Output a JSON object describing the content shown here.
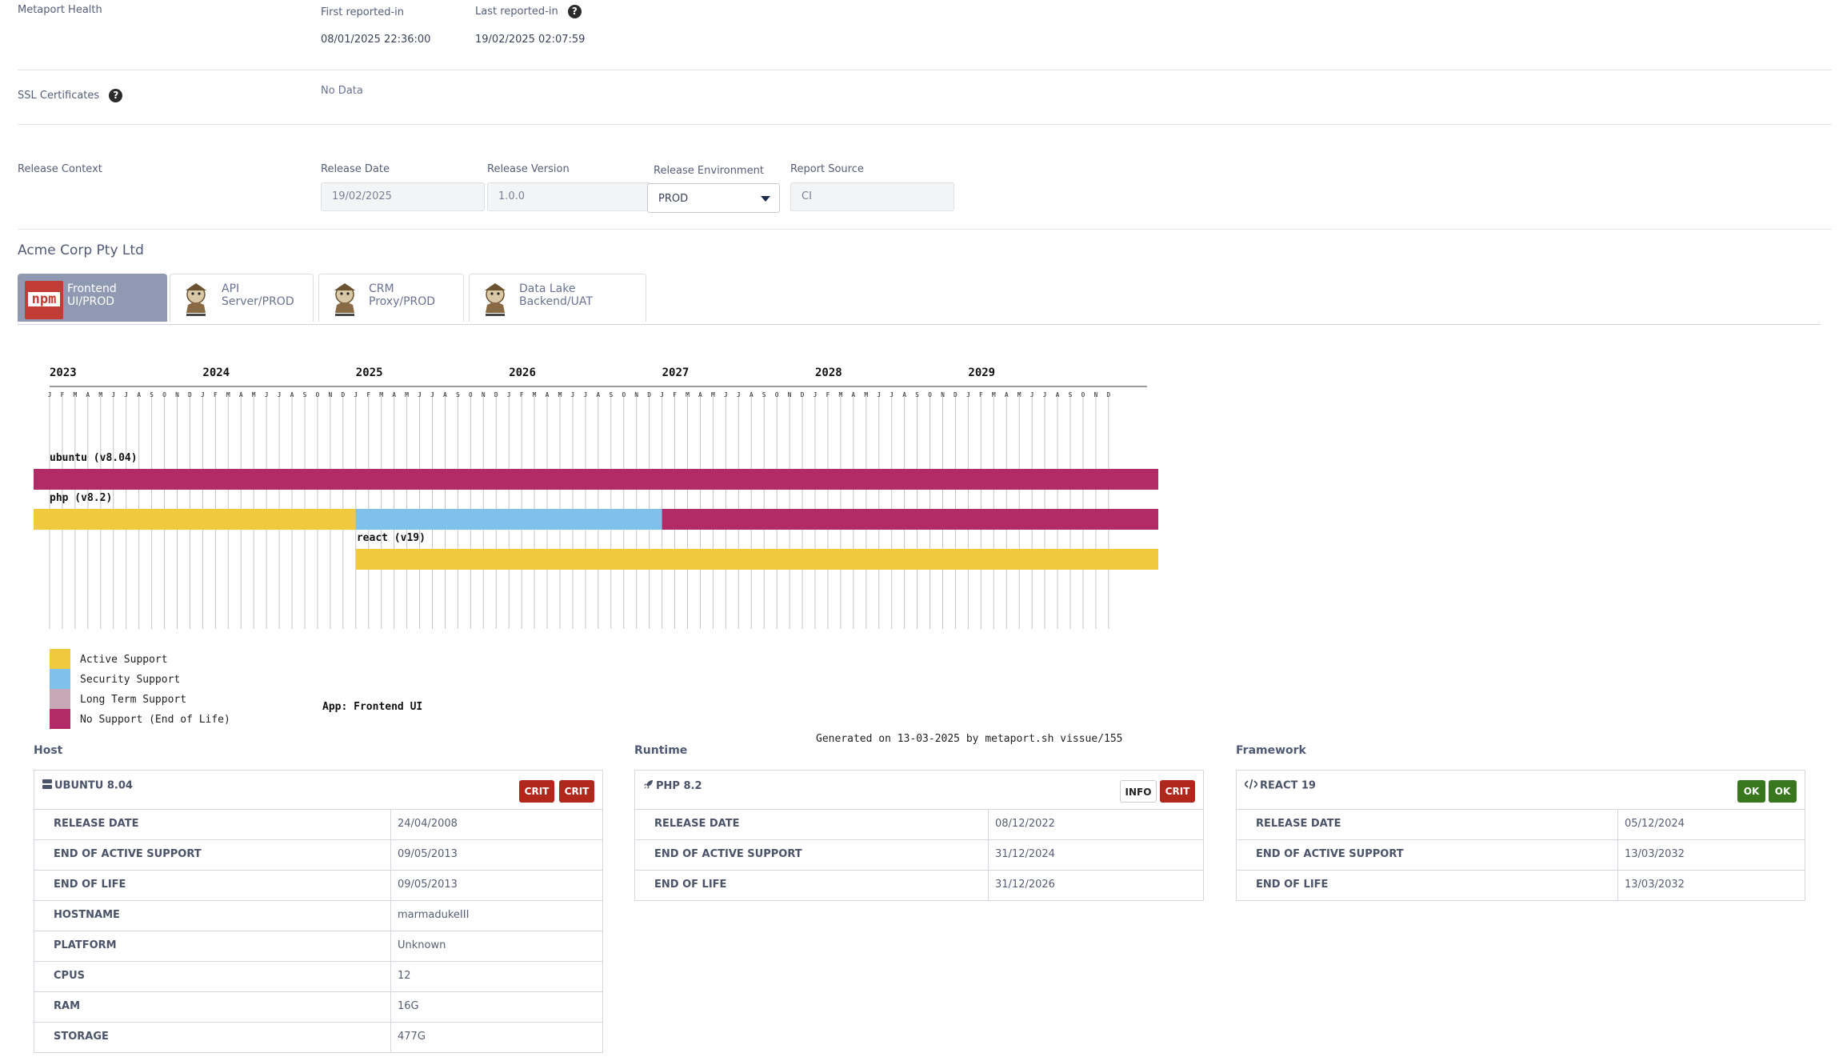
{
  "health": {
    "label": "Metaport Health",
    "first_label": "First reported-in",
    "first_value": "08/01/2025 22:36:00",
    "last_label": "Last reported-in",
    "last_value": "19/02/2025 02:07:59",
    "help": "?"
  },
  "ssl": {
    "label": "SSL Certificates",
    "value": "No Data",
    "help": "?"
  },
  "release": {
    "label": "Release Context",
    "date_label": "Release Date",
    "date_value": "19/02/2025",
    "version_label": "Release Version",
    "version_value": "1.0.0",
    "env_label": "Release Environment",
    "env_value": "PROD",
    "source_label": "Report Source",
    "source_value": "CI"
  },
  "org": "Acme Corp Pty Ltd",
  "tabs": [
    {
      "label": "Frontend UI/PROD",
      "icon": "npm-icon",
      "active": true
    },
    {
      "label": "API Server/PROD",
      "icon": "composer-icon"
    },
    {
      "label": "CRM Proxy/PROD",
      "icon": "composer-icon"
    },
    {
      "label": "Data Lake Backend/UAT",
      "icon": "composer-icon"
    }
  ],
  "npm_logo_text": "npm",
  "chart_data": {
    "type": "gantt",
    "years": [
      "2023",
      "2024",
      "2025",
      "2026",
      "2027",
      "2028",
      "2029"
    ],
    "month_initials": [
      "J",
      "F",
      "M",
      "A",
      "M",
      "J",
      "J",
      "A",
      "S",
      "O",
      "N",
      "D"
    ],
    "bars": [
      {
        "label": "ubuntu (v8.04)",
        "segments": [
          {
            "status": "No Support (End of Life)",
            "start": "2022-12",
            "end": "2029-12"
          }
        ]
      },
      {
        "label": "php (v8.2)",
        "segments": [
          {
            "status": "Active Support",
            "start": "2022-12",
            "end": "2024-12"
          },
          {
            "status": "Security Support",
            "start": "2024-12",
            "end": "2026-12"
          },
          {
            "status": "No Support (End of Life)",
            "start": "2026-12",
            "end": "2029-12"
          }
        ]
      },
      {
        "label": "react (v19)",
        "segments": [
          {
            "status": "Active Support",
            "start": "2024-12",
            "end": "2029-12"
          }
        ]
      }
    ],
    "legend": [
      {
        "label": "Active Support",
        "color": "#f0c93e"
      },
      {
        "label": "Security Support",
        "color": "#7fc1ea"
      },
      {
        "label": "Long Term Support",
        "color": "#c7a9b6"
      },
      {
        "label": "No Support (End of Life)",
        "color": "#b22a66"
      }
    ],
    "app_label": "App: Frontend UI",
    "footer": "Generated on 13-03-2025 by metaport.sh vissue/155"
  },
  "sections": {
    "host": "Host",
    "runtime": "Runtime",
    "framework": "Framework"
  },
  "host_card": {
    "title": "UBUNTU 8.04",
    "icon": "server-icon",
    "badges": [
      "CRIT",
      "CRIT"
    ],
    "rows": [
      {
        "k": "RELEASE DATE",
        "v": "24/04/2008"
      },
      {
        "k": "END OF ACTIVE SUPPORT",
        "v": "09/05/2013"
      },
      {
        "k": "END OF LIFE",
        "v": "09/05/2013"
      },
      {
        "k": "HOSTNAME",
        "v": "marmadukeIII"
      },
      {
        "k": "PLATFORM",
        "v": "Unknown"
      },
      {
        "k": "CPUS",
        "v": "12"
      },
      {
        "k": "RAM",
        "v": "16G"
      },
      {
        "k": "STORAGE",
        "v": "477G"
      }
    ]
  },
  "runtime_card": {
    "title": "PHP 8.2",
    "icon": "rocket-icon",
    "badges": [
      "INFO",
      "CRIT"
    ],
    "rows": [
      {
        "k": "RELEASE DATE",
        "v": "08/12/2022"
      },
      {
        "k": "END OF ACTIVE SUPPORT",
        "v": "31/12/2024"
      },
      {
        "k": "END OF LIFE",
        "v": "31/12/2026"
      }
    ]
  },
  "framework_card": {
    "title": "REACT 19",
    "icon": "code-icon",
    "badges": [
      "OK",
      "OK"
    ],
    "rows": [
      {
        "k": "RELEASE DATE",
        "v": "05/12/2024"
      },
      {
        "k": "END OF ACTIVE SUPPORT",
        "v": "13/03/2032"
      },
      {
        "k": "END OF LIFE",
        "v": "13/03/2032"
      }
    ]
  }
}
